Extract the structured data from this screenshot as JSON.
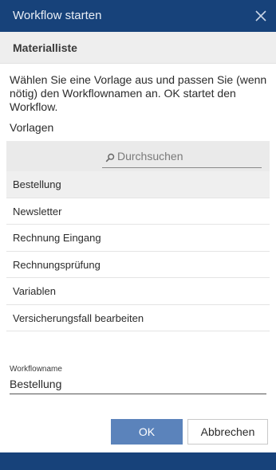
{
  "dialog": {
    "title": "Workflow starten",
    "close_icon": "close-icon"
  },
  "section": {
    "title": "Materialliste"
  },
  "description": "Wählen Sie eine Vorlage aus und passen Sie (wenn nötig) den Workflownamen an. OK startet den Workflow.",
  "templates": {
    "label": "Vorlagen",
    "search_placeholder": "Durchsuchen",
    "search_icon": "search-icon",
    "items": [
      {
        "label": "Bestellung",
        "selected": true
      },
      {
        "label": "Newsletter"
      },
      {
        "label": "Rechnung Eingang"
      },
      {
        "label": "Rechnungsprüfung"
      },
      {
        "label": "Variablen"
      },
      {
        "label": "Versicherungsfall bearbeiten"
      }
    ]
  },
  "workflowname": {
    "label": "Workflowname",
    "value": "Bestellung"
  },
  "buttons": {
    "ok": "OK",
    "cancel": "Abbrechen"
  },
  "colors": {
    "titlebar": "#17427a",
    "primary_button": "#5b83bb",
    "header_bg": "#eeeeee"
  }
}
